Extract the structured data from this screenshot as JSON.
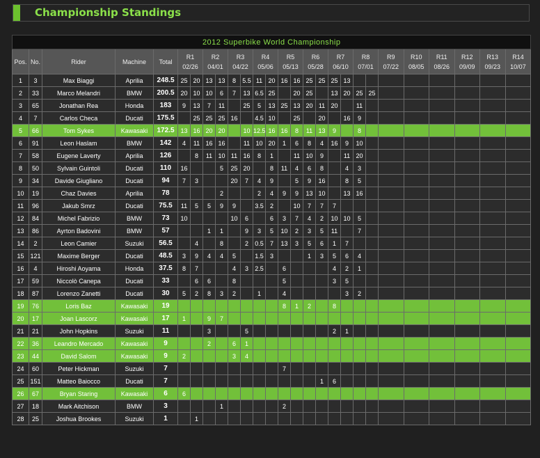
{
  "header": {
    "title": "Championship Standings"
  },
  "colors": {
    "accent": "#72c03a",
    "title_text": "#8be04a"
  },
  "table": {
    "title": "2012 Superbike World Championship",
    "headers": {
      "pos": "Pos.",
      "no": "No.",
      "rider": "Rider",
      "machine": "Machine",
      "total": "Total"
    },
    "rounds": [
      {
        "label": "R1",
        "date": "02/26",
        "dual": true
      },
      {
        "label": "R2",
        "date": "04/01",
        "dual": true
      },
      {
        "label": "R3",
        "date": "04/22",
        "dual": true
      },
      {
        "label": "R4",
        "date": "05/06",
        "dual": true
      },
      {
        "label": "R5",
        "date": "05/13",
        "dual": true
      },
      {
        "label": "R6",
        "date": "05/28",
        "dual": true
      },
      {
        "label": "R7",
        "date": "06/10",
        "dual": true
      },
      {
        "label": "R8",
        "date": "07/01",
        "dual": true
      },
      {
        "label": "R9",
        "date": "07/22",
        "dual": false
      },
      {
        "label": "R10",
        "date": "08/05",
        "dual": false
      },
      {
        "label": "R11",
        "date": "08/26",
        "dual": false
      },
      {
        "label": "R12",
        "date": "09/09",
        "dual": false
      },
      {
        "label": "R13",
        "date": "09/23",
        "dual": false
      },
      {
        "label": "R14",
        "date": "10/07",
        "dual": false
      }
    ],
    "rows": [
      {
        "pos": "1",
        "no": "3",
        "rider": "Max Biaggi",
        "machine": "Aprilia",
        "total": "248.5",
        "hl": false,
        "results": [
          "25",
          "20",
          "13",
          "13",
          "8",
          "5.5",
          "11",
          "20",
          "16",
          "16",
          "25",
          "25",
          "25",
          "13"
        ]
      },
      {
        "pos": "2",
        "no": "33",
        "rider": "Marco Melandri",
        "machine": "BMW",
        "total": "200.5",
        "hl": false,
        "results": [
          "20",
          "10",
          "10",
          "6",
          "7",
          "13",
          "6.5",
          "25",
          "",
          "20",
          "25",
          "",
          "13",
          "20",
          "25",
          "25"
        ]
      },
      {
        "pos": "3",
        "no": "65",
        "rider": "Jonathan Rea",
        "machine": "Honda",
        "total": "183",
        "hl": false,
        "results": [
          "9",
          "13",
          "7",
          "11",
          "",
          "25",
          "5",
          "13",
          "25",
          "13",
          "20",
          "11",
          "20",
          "",
          "11",
          ""
        ]
      },
      {
        "pos": "4",
        "no": "7",
        "rider": "Carlos Checa",
        "machine": "Ducati",
        "total": "175.5",
        "hl": false,
        "results": [
          "",
          "25",
          "25",
          "25",
          "16",
          "",
          "4.5",
          "10",
          "",
          "25",
          "",
          "20",
          "",
          "16",
          "9",
          ""
        ]
      },
      {
        "pos": "5",
        "no": "66",
        "rider": "Tom Sykes",
        "machine": "Kawasaki",
        "total": "172.5",
        "hl": true,
        "results": [
          "13",
          "16",
          "20",
          "20",
          "",
          "10",
          "12.5",
          "16",
          "16",
          "8",
          "11",
          "13",
          "9",
          "",
          "8",
          ""
        ]
      },
      {
        "pos": "6",
        "no": "91",
        "rider": "Leon Haslam",
        "machine": "BMW",
        "total": "142",
        "hl": false,
        "results": [
          "4",
          "11",
          "16",
          "16",
          "",
          "11",
          "10",
          "20",
          "1",
          "6",
          "8",
          "4",
          "16",
          "9",
          "10",
          ""
        ]
      },
      {
        "pos": "7",
        "no": "58",
        "rider": "Eugene Laverty",
        "machine": "Aprilia",
        "total": "126",
        "hl": false,
        "results": [
          "",
          "8",
          "11",
          "10",
          "11",
          "16",
          "8",
          "1",
          "",
          "11",
          "10",
          "9",
          "",
          "11",
          "20",
          ""
        ]
      },
      {
        "pos": "8",
        "no": "50",
        "rider": "Sylvain Guintoli",
        "machine": "Ducati",
        "total": "110",
        "hl": false,
        "results": [
          "16",
          "",
          "",
          "5",
          "25",
          "20",
          "",
          "8",
          "11",
          "4",
          "6",
          "8",
          "",
          "4",
          "3",
          ""
        ]
      },
      {
        "pos": "9",
        "no": "34",
        "rider": "Davide Giugliano",
        "machine": "Ducati",
        "total": "94",
        "hl": false,
        "results": [
          "7",
          "3",
          "",
          "",
          "20",
          "7",
          "4",
          "9",
          "",
          "5",
          "9",
          "16",
          "",
          "8",
          "5",
          ""
        ]
      },
      {
        "pos": "10",
        "no": "19",
        "rider": "Chaz Davies",
        "machine": "Aprilia",
        "total": "78",
        "hl": false,
        "results": [
          "",
          "",
          "",
          "2",
          "",
          "",
          "2",
          "4",
          "9",
          "9",
          "13",
          "10",
          "",
          "13",
          "16",
          ""
        ]
      },
      {
        "pos": "11",
        "no": "96",
        "rider": "Jakub Smrz",
        "machine": "Ducati",
        "total": "75.5",
        "hl": false,
        "results": [
          "11",
          "5",
          "5",
          "9",
          "9",
          "",
          "3.5",
          "2",
          "",
          "10",
          "7",
          "7",
          "7",
          "",
          "",
          ""
        ]
      },
      {
        "pos": "12",
        "no": "84",
        "rider": "Michel Fabrizio",
        "machine": "BMW",
        "total": "73",
        "hl": false,
        "results": [
          "10",
          "",
          "",
          "",
          "10",
          "6",
          "",
          "6",
          "3",
          "7",
          "4",
          "2",
          "10",
          "10",
          "5",
          ""
        ]
      },
      {
        "pos": "13",
        "no": "86",
        "rider": "Ayrton Badovini",
        "machine": "BMW",
        "total": "57",
        "hl": false,
        "results": [
          "",
          "",
          "1",
          "1",
          "",
          "9",
          "3",
          "5",
          "10",
          "2",
          "3",
          "5",
          "11",
          "",
          "7",
          ""
        ]
      },
      {
        "pos": "14",
        "no": "2",
        "rider": "Leon Camier",
        "machine": "Suzuki",
        "total": "56.5",
        "hl": false,
        "results": [
          "",
          "4",
          "",
          "8",
          "",
          "2",
          "0.5",
          "7",
          "13",
          "3",
          "5",
          "6",
          "1",
          "7",
          "",
          ""
        ]
      },
      {
        "pos": "15",
        "no": "121",
        "rider": "Maxime Berger",
        "machine": "Ducati",
        "total": "48.5",
        "hl": false,
        "results": [
          "3",
          "9",
          "4",
          "4",
          "5",
          "",
          "1.5",
          "3",
          "",
          "",
          "1",
          "3",
          "5",
          "6",
          "4",
          ""
        ]
      },
      {
        "pos": "16",
        "no": "4",
        "rider": "Hiroshi Aoyama",
        "machine": "Honda",
        "total": "37.5",
        "hl": false,
        "results": [
          "8",
          "7",
          "",
          "",
          "4",
          "3",
          "2.5",
          "",
          "6",
          "",
          "",
          "",
          "4",
          "2",
          "1",
          ""
        ]
      },
      {
        "pos": "17",
        "no": "59",
        "rider": "Niccolò Canepa",
        "machine": "Ducati",
        "total": "33",
        "hl": false,
        "results": [
          "",
          "6",
          "6",
          "",
          "8",
          "",
          "",
          "",
          "5",
          "",
          "",
          "",
          "3",
          "5",
          "",
          ""
        ]
      },
      {
        "pos": "18",
        "no": "87",
        "rider": "Lorenzo Zanetti",
        "machine": "Ducati",
        "total": "30",
        "hl": false,
        "results": [
          "5",
          "2",
          "8",
          "3",
          "2",
          "",
          "1",
          "",
          "4",
          "",
          "",
          "",
          "",
          "3",
          "2",
          ""
        ]
      },
      {
        "pos": "19",
        "no": "76",
        "rider": "Loris Baz",
        "machine": "Kawasaki",
        "total": "19",
        "hl": true,
        "results": [
          "",
          "",
          "",
          "",
          "",
          "",
          "",
          "",
          "8",
          "1",
          "2",
          "",
          "8",
          "",
          "",
          ""
        ]
      },
      {
        "pos": "20",
        "no": "17",
        "rider": "Joan Lascorz",
        "machine": "Kawasaki",
        "total": "17",
        "hl": true,
        "results": [
          "1",
          "",
          "9",
          "7",
          "",
          "",
          "",
          "",
          "",
          "",
          "",
          "",
          "",
          "",
          "",
          ""
        ]
      },
      {
        "pos": "21",
        "no": "21",
        "rider": "John Hopkins",
        "machine": "Suzuki",
        "total": "11",
        "hl": false,
        "results": [
          "",
          "",
          "3",
          "",
          "",
          "5",
          "",
          "",
          "",
          "",
          "",
          "",
          "2",
          "1",
          "",
          ""
        ]
      },
      {
        "pos": "22",
        "no": "36",
        "rider": "Leandro Mercado",
        "machine": "Kawasaki",
        "total": "9",
        "hl": true,
        "results": [
          "",
          "",
          "2",
          "",
          "6",
          "1",
          "",
          "",
          "",
          "",
          "",
          "",
          "",
          "",
          "",
          ""
        ]
      },
      {
        "pos": "23",
        "no": "44",
        "rider": "David Salom",
        "machine": "Kawasaki",
        "total": "9",
        "hl": true,
        "results": [
          "2",
          "",
          "",
          "",
          "3",
          "4",
          "",
          "",
          "",
          "",
          "",
          "",
          "",
          "",
          "",
          ""
        ]
      },
      {
        "pos": "24",
        "no": "60",
        "rider": "Peter Hickman",
        "machine": "Suzuki",
        "total": "7",
        "hl": false,
        "results": [
          "",
          "",
          "",
          "",
          "",
          "",
          "",
          "",
          "7",
          "",
          "",
          "",
          "",
          "",
          "",
          ""
        ]
      },
      {
        "pos": "25",
        "no": "151",
        "rider": "Matteo Baiocco",
        "machine": "Ducati",
        "total": "7",
        "hl": false,
        "results": [
          "",
          "",
          "",
          "",
          "",
          "",
          "",
          "",
          "",
          "",
          "",
          "1",
          "6",
          "",
          "",
          ""
        ]
      },
      {
        "pos": "26",
        "no": "67",
        "rider": "Bryan Staring",
        "machine": "Kawasaki",
        "total": "6",
        "hl": true,
        "results": [
          "6",
          "",
          "",
          "",
          "",
          "",
          "",
          "",
          "",
          "",
          "",
          "",
          "",
          "",
          "",
          ""
        ]
      },
      {
        "pos": "27",
        "no": "18",
        "rider": "Mark Aitchison",
        "machine": "BMW",
        "total": "3",
        "hl": false,
        "results": [
          "",
          "",
          "",
          "1",
          "",
          "",
          "",
          "",
          "2",
          "",
          "",
          "",
          "",
          "",
          "",
          ""
        ]
      },
      {
        "pos": "28",
        "no": "25",
        "rider": "Joshua Brookes",
        "machine": "Suzuki",
        "total": "1",
        "hl": false,
        "results": [
          "",
          "1",
          "",
          "",
          "",
          "",
          "",
          "",
          "",
          "",
          "",
          "",
          "",
          "",
          "",
          ""
        ]
      }
    ]
  }
}
